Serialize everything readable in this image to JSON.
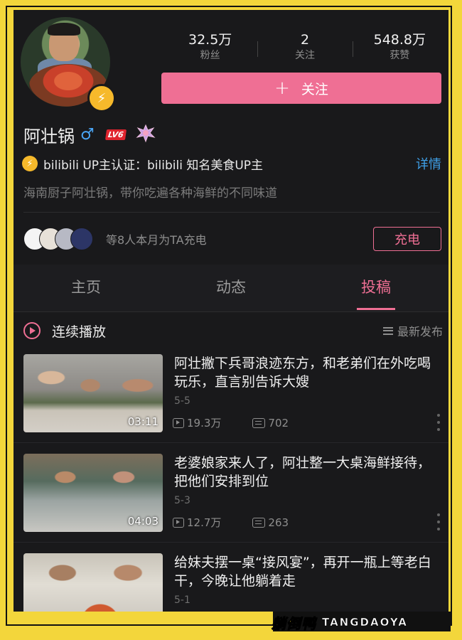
{
  "profile": {
    "name": "阿壮锅",
    "gender_symbol": "♂",
    "level": "LV6",
    "certification": "bilibili UP主认证：bilibili 知名美食UP主",
    "detail_link": "详情",
    "bio": "海南厨子阿壮锅，带你吃遍各种海鲜的不同味道"
  },
  "stats": [
    {
      "value": "32.5万",
      "label": "粉丝"
    },
    {
      "value": "2",
      "label": "关注"
    },
    {
      "value": "548.8万",
      "label": "获赞"
    }
  ],
  "follow_button": {
    "icon": "+",
    "label": "关注"
  },
  "charge": {
    "text": "等8人本月为TA充电",
    "button": "充电"
  },
  "tabs": [
    {
      "label": "主页",
      "active": false
    },
    {
      "label": "动态",
      "active": false
    },
    {
      "label": "投稿",
      "active": true
    }
  ],
  "list_header": {
    "play_label": "连续播放",
    "sort_label": "最新发布"
  },
  "videos": [
    {
      "title": "阿壮撇下兵哥浪迹东方，和老弟们在外吃喝玩乐，直言别告诉大嫂",
      "date": "5-5",
      "views": "19.3万",
      "comments": "702",
      "duration": "03:11"
    },
    {
      "title": "老婆娘家来人了，阿壮整一大桌海鲜接待，把他们安排到位",
      "date": "5-3",
      "views": "12.7万",
      "comments": "263",
      "duration": "04:03"
    },
    {
      "title": "给妹夫摆一桌“接风宴”，再开一瓶上等老白干，今晚让他躺着走",
      "date": "5-1",
      "views": "",
      "comments": "",
      "duration": ""
    }
  ],
  "watermark": {
    "cn": "躺倒鸭",
    "en": "TANGDAOYA"
  },
  "colors": {
    "accent": "#ef6f94",
    "link": "#3fa0e8",
    "background": "#19191b",
    "frame": "#f3d63b"
  }
}
